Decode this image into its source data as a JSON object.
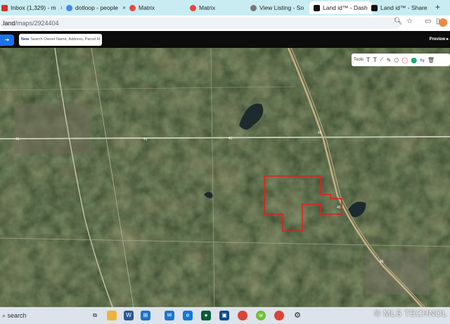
{
  "browser": {
    "tabs": [
      {
        "label": "Inbox (1,329) - m",
        "icon": "gmail-icon",
        "color": "#d93025"
      },
      {
        "label": "dotloop - people",
        "icon": "dotloop-icon",
        "color": "#4285f4"
      },
      {
        "label": "Matrix",
        "icon": "matrix-icon",
        "color": "#e8453c"
      },
      {
        "label": "Matrix",
        "icon": "matrix-icon",
        "color": "#e8453c"
      },
      {
        "label": "View Listing - So",
        "icon": "globe-icon",
        "color": "#555555"
      },
      {
        "label": "Land id™ - Dash",
        "icon": "landid-icon",
        "color": "#111111",
        "active": true
      },
      {
        "label": "Land id™ - Share",
        "icon": "landid-icon",
        "color": "#111111"
      }
    ],
    "new_tab": "+",
    "url_host": ".land",
    "url_path": "/maps/2924404"
  },
  "app": {
    "search_new_label": "New",
    "search_placeholder": "Search Owner Name, Address, Parcel Id",
    "preview_label": "Preview ▸",
    "tools_label": "Tools"
  },
  "map": {
    "road_labels": [
      "41",
      "41",
      "41",
      "45",
      "45",
      "45"
    ],
    "colors": {
      "parcel_outline": "#e02020",
      "highway": "#c8b48a",
      "road": "#d8d8c8"
    }
  },
  "taskbar": {
    "search_label": "search"
  },
  "watermark": "© MLS TECHNOL"
}
